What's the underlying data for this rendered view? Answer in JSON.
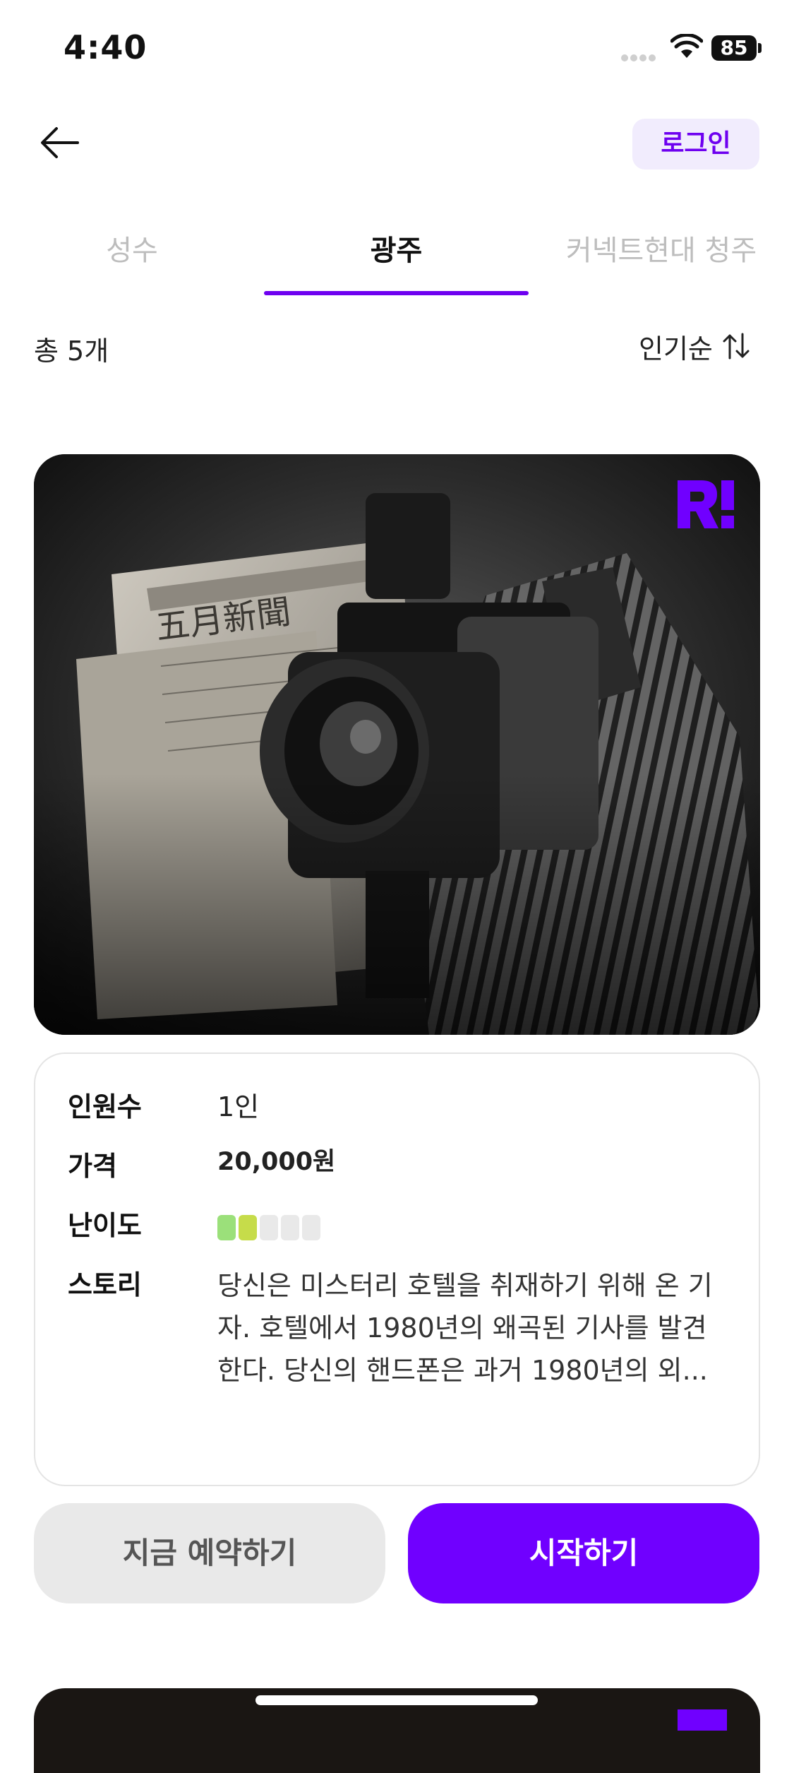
{
  "status_bar": {
    "time": "4:40",
    "battery": "85"
  },
  "header": {
    "login_label": "로그인"
  },
  "tabs": [
    {
      "label": "성수",
      "active": false
    },
    {
      "label": "광주",
      "active": true
    },
    {
      "label": "커넥트현대 청주",
      "active": false
    }
  ],
  "list": {
    "total": "총 5개",
    "sort_label": "인기순"
  },
  "card": {
    "poster_title": "오월의 신문",
    "rows": {
      "people_label": "인원수",
      "people_value": "1인",
      "price_label": "가격",
      "price_value": "20,000원",
      "difficulty_label": "난이도",
      "difficulty_level": 2,
      "difficulty_max": 5,
      "story_label": "스토리",
      "story_value": "당신은 미스터리 호텔을 취재하기 위해 온 기자. 호텔에서 1980년의 왜곡된 기사를 발견한다. 당신의 핸드폰은 과거 1980년의 외..."
    },
    "reserve_label": "지금 예약하기",
    "start_label": "시작하기"
  },
  "colors": {
    "accent": "#7000ff",
    "difficulty_on": [
      "#9be07a",
      "#c6dc4a"
    ],
    "difficulty_off": "#e9e9e9"
  }
}
